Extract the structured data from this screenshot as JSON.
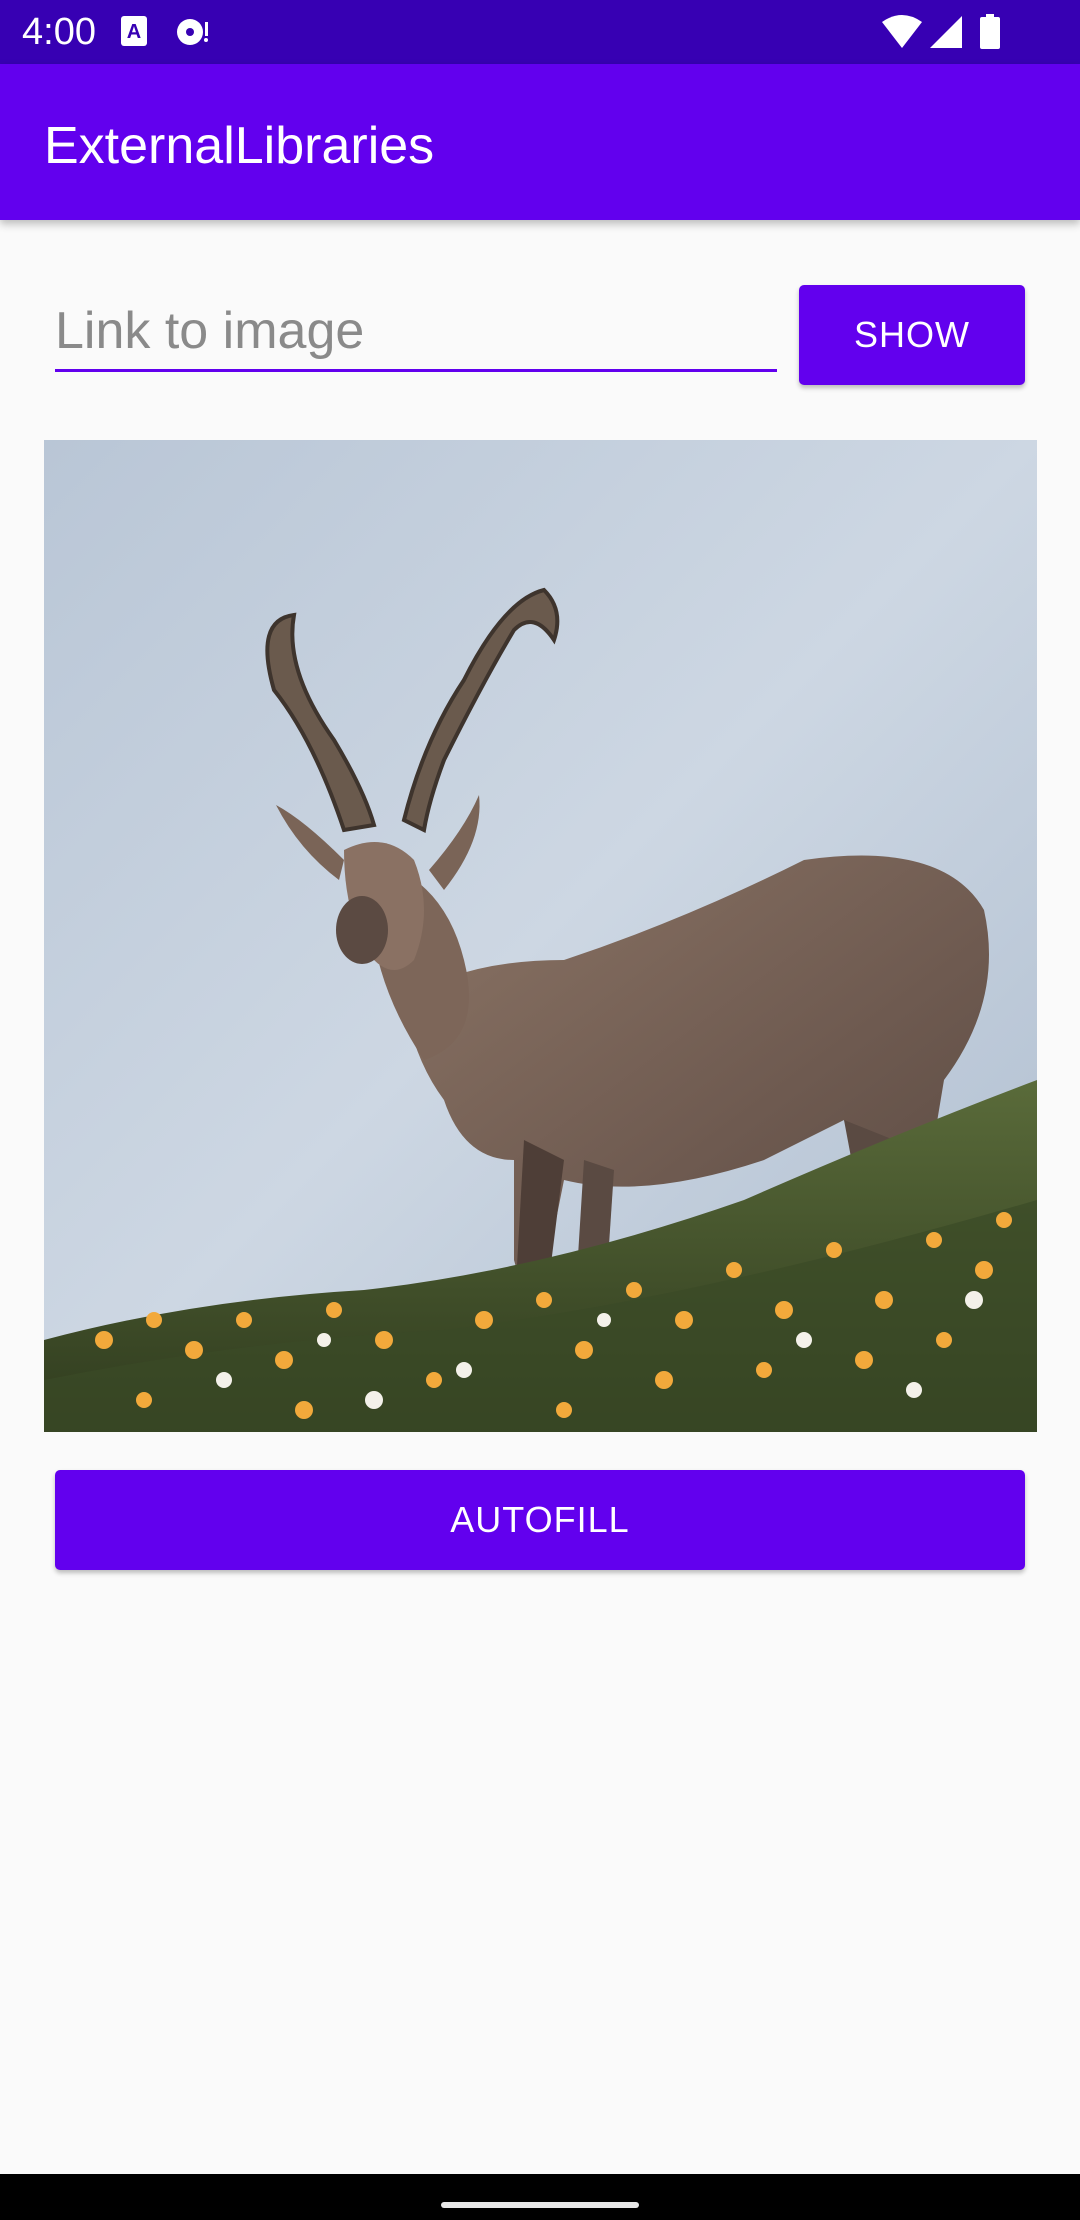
{
  "status_bar": {
    "time": "4:00",
    "icons": [
      "keyboard-a-icon",
      "media-disc-icon",
      "wifi-icon",
      "cellular-signal-icon",
      "battery-icon"
    ]
  },
  "app_bar": {
    "title": "ExternalLibraries"
  },
  "form": {
    "url_placeholder": "Link to image",
    "url_value": "",
    "show_label": "SHOW"
  },
  "image": {
    "subject": "ibex-on-flowered-hillside-photo"
  },
  "actions": {
    "autofill_label": "AUTOFILL"
  },
  "colors": {
    "status_bar": "#3700b3",
    "primary": "#6200ee",
    "background": "#fafafa"
  }
}
